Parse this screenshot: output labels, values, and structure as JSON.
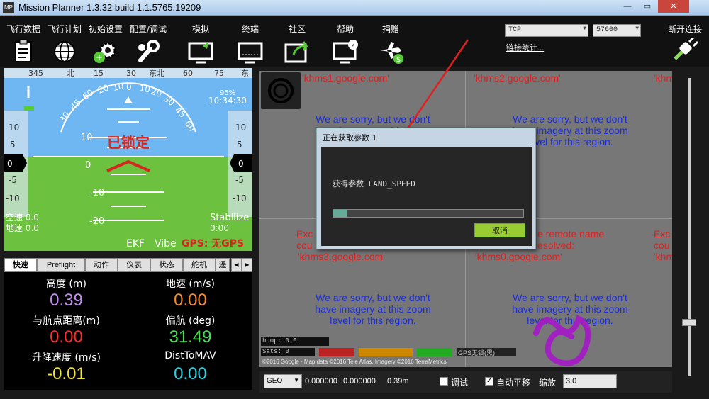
{
  "window": {
    "title": "Mission Planner 1.3.32 build 1.1.5765.19209",
    "app_icon_text": "MP",
    "minimize": "—",
    "maximize": "▭",
    "close": "✕"
  },
  "toolbar": {
    "items": [
      {
        "label": "飞行数据",
        "icon": "clipboard-icon"
      },
      {
        "label": "飞行计划",
        "icon": "globe-icon"
      },
      {
        "label": "初始设置",
        "icon": "gear-plus-icon"
      },
      {
        "label": "配置/调试",
        "icon": "wrench-icon"
      },
      {
        "label": "模拟",
        "icon": "monitor-plane-icon"
      },
      {
        "label": "终端",
        "icon": "terminal-icon"
      },
      {
        "label": "社区",
        "icon": "share-icon"
      },
      {
        "label": "帮助",
        "icon": "help-monitor-icon"
      },
      {
        "label": "捐赠",
        "icon": "plane-dollar-icon"
      }
    ],
    "connection_type": "TCP",
    "baud_rate": "57600",
    "stats_link": "链接统计...",
    "disconnect_label": "断开连接"
  },
  "hud": {
    "heading_ticks": [
      "345",
      "北",
      "15",
      "30",
      "东北",
      "60",
      "75",
      "东"
    ],
    "pitch_labels": [
      "10",
      "0",
      "-10",
      "-20"
    ],
    "left_tape": [
      "10",
      "5",
      "0",
      "-5",
      "-10"
    ],
    "right_tape": [
      "10",
      "5",
      "0",
      "-5",
      "-10"
    ],
    "roll_labels": [
      "30",
      "45",
      "60",
      "20",
      "10",
      "0",
      "10",
      "20",
      "30",
      "45",
      "60"
    ],
    "status_text": "已锁定",
    "battery": "95%",
    "time": "10:34:30",
    "airspeed": "空速 0.0",
    "groundspeed": "地速 0.0",
    "mode": "Stabilize",
    "mode_time": "0:00",
    "ekf": "EKF",
    "vibe": "Vibe",
    "gps": "GPS: 无GPS",
    "colors": {
      "sky": "#6fb7f2",
      "ground": "#6cc13f",
      "warning": "#d6271e"
    }
  },
  "tabs": [
    {
      "label": "快速",
      "active": true
    },
    {
      "label": "Preflight",
      "active": false
    },
    {
      "label": "动作",
      "active": false
    },
    {
      "label": "仪表",
      "active": false
    },
    {
      "label": "状态",
      "active": false
    },
    {
      "label": "舵机",
      "active": false
    },
    {
      "label": "遥",
      "active": false
    }
  ],
  "tab_scroll_left": "◀",
  "tab_scroll_right": "▶",
  "quick": [
    {
      "label": "高度 (m)",
      "value": "0.39",
      "color": "#c38cf2"
    },
    {
      "label": "地速 (m/s)",
      "value": "0.00",
      "color": "#ff8a1e"
    },
    {
      "label": "与航点距离(m)",
      "value": "0.00",
      "color": "#ff2a2a"
    },
    {
      "label": "偏航 (deg)",
      "value": "31.49",
      "color": "#44e04a"
    },
    {
      "label": "升降速度 (m/s)",
      "value": "-0.01",
      "color": "#f3e33a"
    },
    {
      "label": "DistToMAV",
      "value": "0.00",
      "color": "#22d5e6"
    }
  ],
  "map": {
    "tile_labels": [
      "'khms1.google.com'",
      "'khms2.google.com'",
      "'khm"
    ],
    "tile_labels_lower": [
      "'khms3.google.com'",
      "'khms0.google.com'",
      "'khm"
    ],
    "sorry_lines": [
      "We are sorry, but we don't",
      "have imagery at this zoom",
      "level for this region."
    ],
    "exc_fragments": [
      "Exc",
      "cou",
      "Exc",
      "cou"
    ],
    "remote_name": "e remote name",
    "resolved": "esolved:",
    "hdop": "hdop: 0.0",
    "sats": "Sats: 0",
    "status_flags": [
      "",
      "",
      "",
      "GPS无锁(黑)"
    ],
    "copyright": "©2016 Google - Map data ©2016 Tele Atlas, Imagery ©2016 TerraMetrics"
  },
  "map_bar": {
    "coord_system": "GEO",
    "lat": "0.000000",
    "lng": "0.000000",
    "alt": "0.39m",
    "debug_label": "调试",
    "debug_checked": false,
    "autopan_label": "自动平移",
    "autopan_checked": true,
    "zoom_label": "缩放",
    "zoom_value": "3.0"
  },
  "dialog": {
    "title": "正在获取参数 1",
    "message": "获得参数 LAND_SPEED",
    "progress": 0.07,
    "cancel": "取消"
  }
}
